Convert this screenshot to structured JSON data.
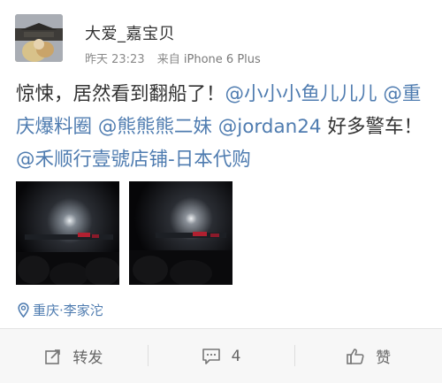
{
  "post": {
    "username": "大爱_嘉宝贝",
    "timestamp": "昨天 23:23",
    "source_prefix": "来自",
    "device": "iPhone 6 Plus",
    "text_parts": {
      "p1": "惊悚，居然看到翻船了！",
      "m1": "@小小小鱼儿儿儿",
      "p2": " ",
      "m2": "@重庆爆料圈",
      "p3": " ",
      "m3": "@熊熊熊二妹",
      "p4": " ",
      "m4": "@jordan24",
      "p5": " 好多警车！",
      "m5": "@禾顺行壹號店铺-日本代购"
    },
    "photos": [
      {
        "name": "night-scene-photo-1"
      },
      {
        "name": "night-scene-photo-2"
      }
    ],
    "location": "重庆·李家沱"
  },
  "actions": {
    "repost_label": "转发",
    "comment_count": "4",
    "like_label": "赞"
  },
  "icons": {
    "avatar": "avatar-image",
    "location": "location-pin-icon",
    "repost": "repost-icon",
    "comment": "comment-icon",
    "like": "thumbs-up-icon"
  },
  "colors": {
    "link": "#4f7cb0",
    "text": "#333333",
    "meta": "#8a8a8a"
  }
}
